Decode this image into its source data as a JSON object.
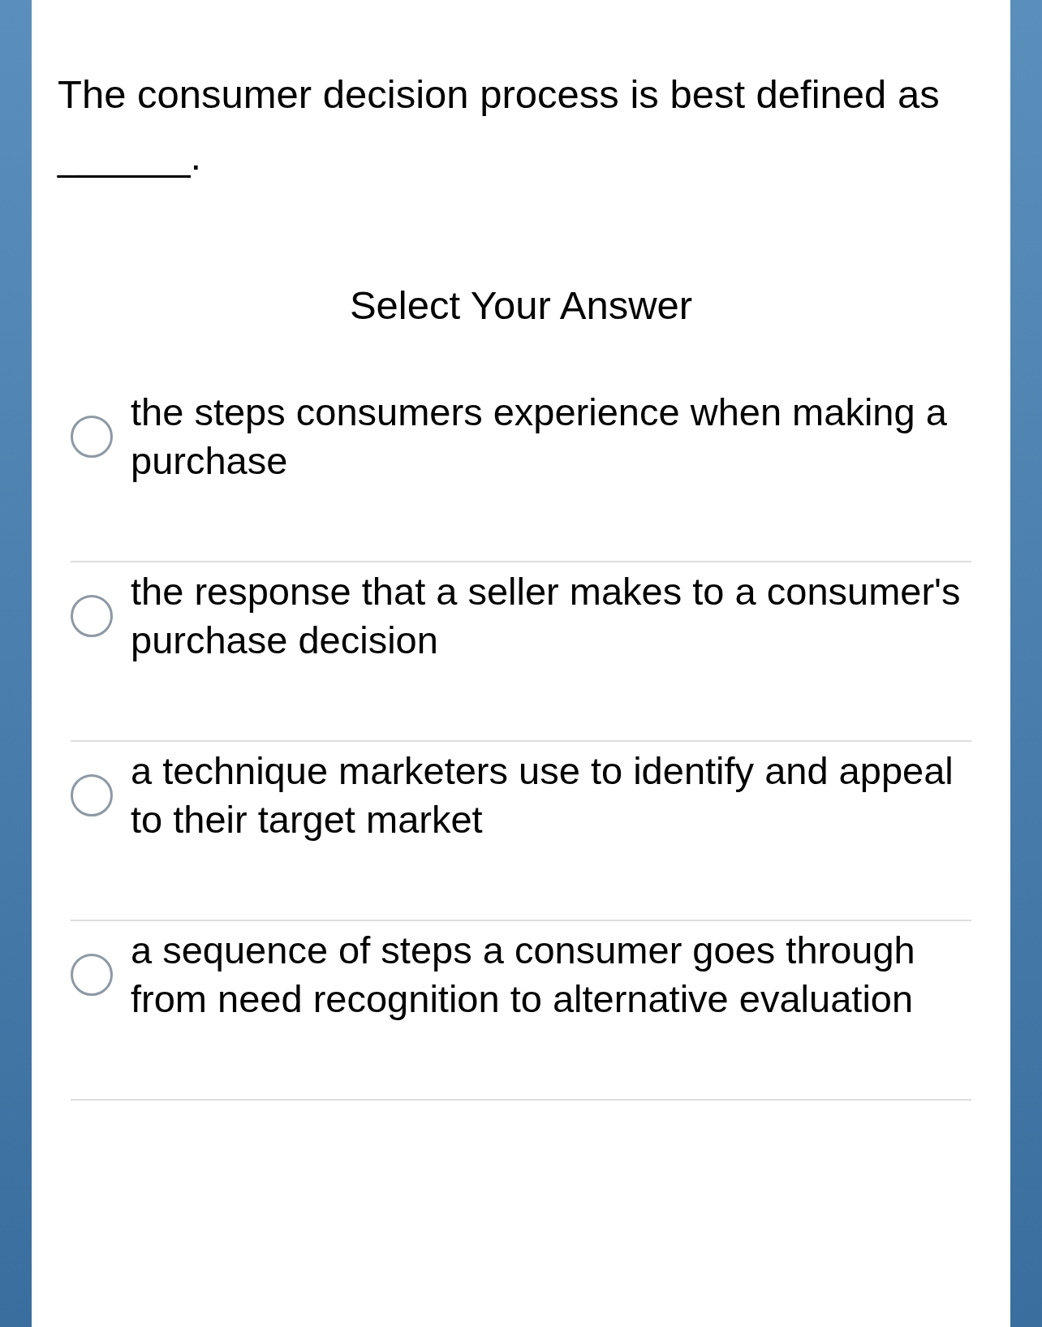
{
  "question": "The consumer decision process is best defined as ______.",
  "prompt": "Select Your Answer",
  "options": [
    {
      "label": "the steps consumers experience when making a purchase",
      "selected": false
    },
    {
      "label": "the response that a seller makes to a consumer's purchase decision",
      "selected": false
    },
    {
      "label": "a technique marketers use to identify and appeal to their target market",
      "selected": false
    },
    {
      "label": "a sequence of steps a consumer goes through from need recognition to alternative evaluation",
      "selected": false
    }
  ]
}
